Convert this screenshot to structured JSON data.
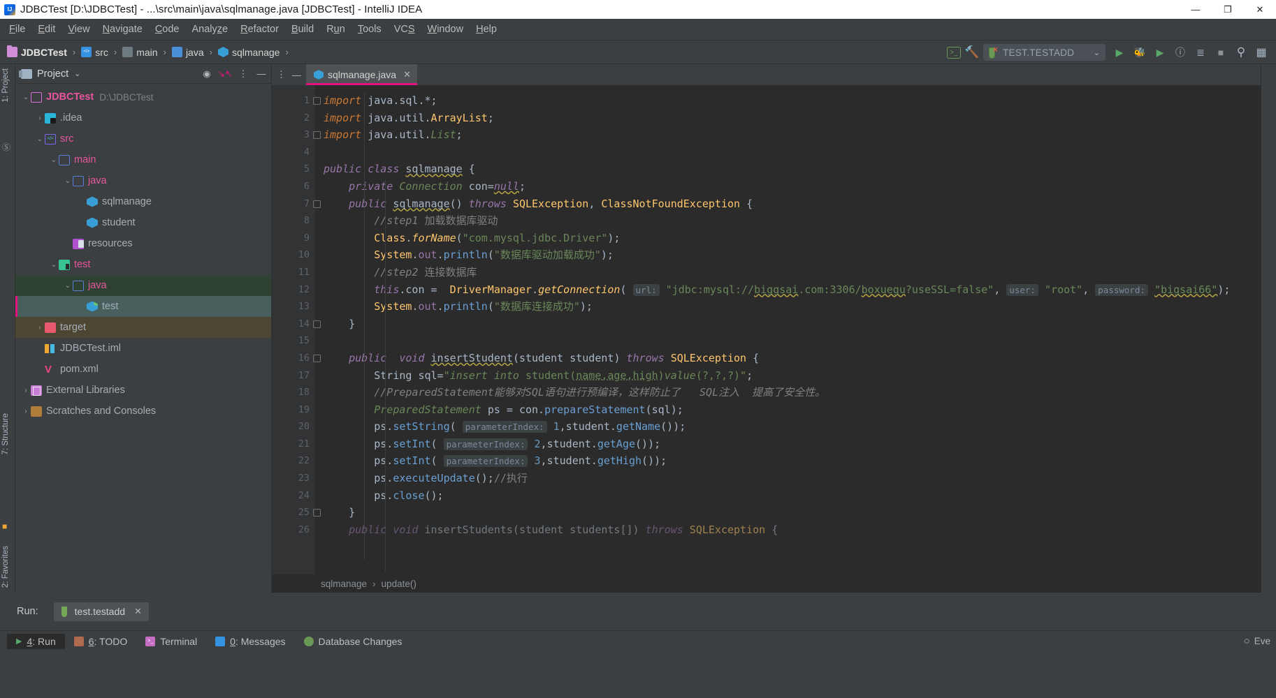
{
  "window": {
    "title": "JDBCTest [D:\\JDBCTest] - ...\\src\\main\\java\\sqlmanage.java [JDBCTest] - IntelliJ IDEA",
    "minimize": "—",
    "maximize": "❐",
    "close": "✕"
  },
  "menu": [
    "File",
    "Edit",
    "View",
    "Navigate",
    "Code",
    "Analyze",
    "Refactor",
    "Build",
    "Run",
    "Tools",
    "VCS",
    "Window",
    "Help"
  ],
  "navbar": {
    "crumbs": [
      {
        "label": "JDBCTest",
        "icon": "folder-project-icon"
      },
      {
        "label": "src",
        "icon": "source-root-icon"
      },
      {
        "label": "main",
        "icon": "folder-icon"
      },
      {
        "label": "java",
        "icon": "folder-icon"
      },
      {
        "label": "sqlmanage",
        "icon": "java-class-icon"
      }
    ],
    "separator": "›",
    "run_config": "TEST.TESTADD",
    "run_config_chevron": "⌄",
    "icons": {
      "terminal": "terminal-icon",
      "build": "hammer-icon",
      "run": "▶",
      "debug": "debug-icon",
      "run_coverage": "coverage-icon",
      "inspect": "ⓘ",
      "todo": "list-icon",
      "stop": "■",
      "search": "⌕",
      "grid": "grid-icon"
    }
  },
  "left_rail": {
    "project_label": "1: Project",
    "structure_label": "7: Structure",
    "favorites_label": "2: Favorites"
  },
  "project_panel": {
    "title": "Project",
    "chevron": "⌄",
    "actions": {
      "locate": "target-icon",
      "collapse": "collapse-all-icon",
      "more": "more-icon",
      "hide": "hide-icon"
    },
    "tree": [
      {
        "label": "JDBCTest",
        "sub": "D:\\JDBCTest",
        "arrow": "⌄",
        "indent": 0,
        "icon": "folder-project-icon",
        "style": "t-root",
        "row": ""
      },
      {
        "label": ".idea",
        "sub": "",
        "arrow": "›",
        "indent": 1,
        "icon": "idea-folder-icon",
        "style": "t-grey",
        "row": ""
      },
      {
        "label": "src",
        "sub": "",
        "arrow": "⌄",
        "indent": 1,
        "icon": "source-root-icon",
        "style": "t-src",
        "row": ""
      },
      {
        "label": "main",
        "sub": "",
        "arrow": "⌄",
        "indent": 2,
        "icon": "folder-icon",
        "style": "t-main",
        "row": ""
      },
      {
        "label": "java",
        "sub": "",
        "arrow": "⌄",
        "indent": 3,
        "icon": "folder-icon",
        "style": "t-java",
        "row": ""
      },
      {
        "label": "sqlmanage",
        "sub": "",
        "arrow": "",
        "indent": 4,
        "icon": "java-class-icon",
        "style": "t-grey",
        "row": ""
      },
      {
        "label": "student",
        "sub": "",
        "arrow": "",
        "indent": 4,
        "icon": "java-class-icon",
        "style": "t-grey",
        "row": ""
      },
      {
        "label": "resources",
        "sub": "",
        "arrow": "",
        "indent": 3,
        "icon": "resources-folder-icon",
        "style": "t-grey",
        "row": ""
      },
      {
        "label": "test",
        "sub": "",
        "arrow": "⌄",
        "indent": 2,
        "icon": "test-root-icon",
        "style": "t-test",
        "row": ""
      },
      {
        "label": "java",
        "sub": "",
        "arrow": "⌄",
        "indent": 3,
        "icon": "folder-icon",
        "style": "t-java",
        "row": "sel-green"
      },
      {
        "label": "test",
        "sub": "",
        "arrow": "",
        "indent": 4,
        "icon": "test-class-icon",
        "style": "t-grey",
        "row": "sel-teal"
      },
      {
        "label": "target",
        "sub": "",
        "arrow": "›",
        "indent": 1,
        "icon": "target-folder-icon",
        "style": "t-grey",
        "row": "sel-brown"
      },
      {
        "label": "JDBCTest.iml",
        "sub": "",
        "arrow": "",
        "indent": 1,
        "icon": "iml-file-icon",
        "style": "t-grey",
        "row": ""
      },
      {
        "label": "pom.xml",
        "sub": "",
        "arrow": "",
        "indent": 1,
        "icon": "maven-pom-icon",
        "style": "t-grey",
        "row": ""
      },
      {
        "label": "External Libraries",
        "sub": "",
        "arrow": "›",
        "indent": 0,
        "icon": "external-libraries-icon",
        "style": "t-grey",
        "row": ""
      },
      {
        "label": "Scratches and Consoles",
        "sub": "",
        "arrow": "›",
        "indent": 0,
        "icon": "scratches-icon",
        "style": "t-grey",
        "row": ""
      }
    ]
  },
  "editor": {
    "tab": {
      "name": "sqlmanage.java",
      "icon": "java-class-icon",
      "close": "✕"
    },
    "tab_actions": {
      "more": "⋮",
      "hide": "—"
    },
    "breadcrumb": {
      "class": "sqlmanage",
      "sep": "›",
      "method": "update()"
    },
    "gutter_numbers": [
      "1",
      "2",
      "3",
      "4",
      "5",
      "6",
      "7",
      "8",
      "9",
      "10",
      "11",
      "12",
      "13",
      "14",
      "15",
      "16",
      "17",
      "18",
      "19",
      "20",
      "21",
      "22",
      "23",
      "24",
      "25",
      "26"
    ]
  },
  "code": {
    "lines": [
      "import java.sql.*;",
      "import java.util.ArrayList;",
      "import java.util.List;",
      "",
      "public class sqlmanage {",
      "    private Connection con=null;",
      "    public sqlmanage() throws SQLException, ClassNotFoundException {",
      "        //step1 加载数据库驱动",
      "        Class.forName(\"com.mysql.jdbc.Driver\");",
      "        System.out.println(\"数据库驱动加载成功\");",
      "        //step2 连接数据库",
      "        this.con =  DriverManager.getConnection( url: \"jdbc:mysql://biggsai.com:3306/boxuegu?useSSL=false\", user: \"root\", password: \"bigsai66\");",
      "        System.out.println(\"数据库连接成功\");",
      "    }",
      "",
      "    public  void insertStudent(student student) throws SQLException {",
      "        String sql=\"insert into student(name,age,high)value(?,?,?)\";",
      "        //PreparedStatement能够对SQL语句进行预编译，这样防止了  SQL注入  提高了安全性。",
      "        PreparedStatement ps = con.prepareStatement(sql);",
      "        ps.setString( parameterIndex: 1,student.getName());",
      "        ps.setInt( parameterIndex: 2,student.getAge());",
      "        ps.setInt( parameterIndex: 3,student.getHigh());",
      "        ps.executeUpdate();//执行",
      "        ps.close();",
      "    }",
      "    public void insertStudents(student students[]) throws SQLException {"
    ],
    "hints": [
      "url:",
      "user:",
      "password:",
      "parameterIndex:"
    ]
  },
  "run_panel": {
    "label": "Run:",
    "tab_name": "test.testadd",
    "tab_close": "✕",
    "tab_icon": "test-tube-icon"
  },
  "statusbar": {
    "items": [
      {
        "num": "4",
        "label": ": Run",
        "icon": "run-play-icon",
        "active": true
      },
      {
        "num": "6",
        "label": ": TODO",
        "icon": "todo-icon",
        "active": false
      },
      {
        "num": "",
        "label": "Terminal",
        "icon": "terminal-icon",
        "active": false
      },
      {
        "num": "0",
        "label": ": Messages",
        "icon": "messages-icon",
        "active": false
      },
      {
        "num": "",
        "label": "Database Changes",
        "icon": "database-icon",
        "active": false
      }
    ],
    "right_text": "Eve"
  },
  "colors": {
    "accent_pink": "#e3127f",
    "panel_bg": "#3c3f41",
    "editor_bg": "#2b2b2b",
    "gutter_bg": "#313335",
    "keyword": "#cc7832",
    "string": "#6a8759",
    "number": "#6897bb",
    "comment": "#808080",
    "method": "#ffc66d",
    "field": "#9876aa",
    "text": "#a9b7c6"
  }
}
